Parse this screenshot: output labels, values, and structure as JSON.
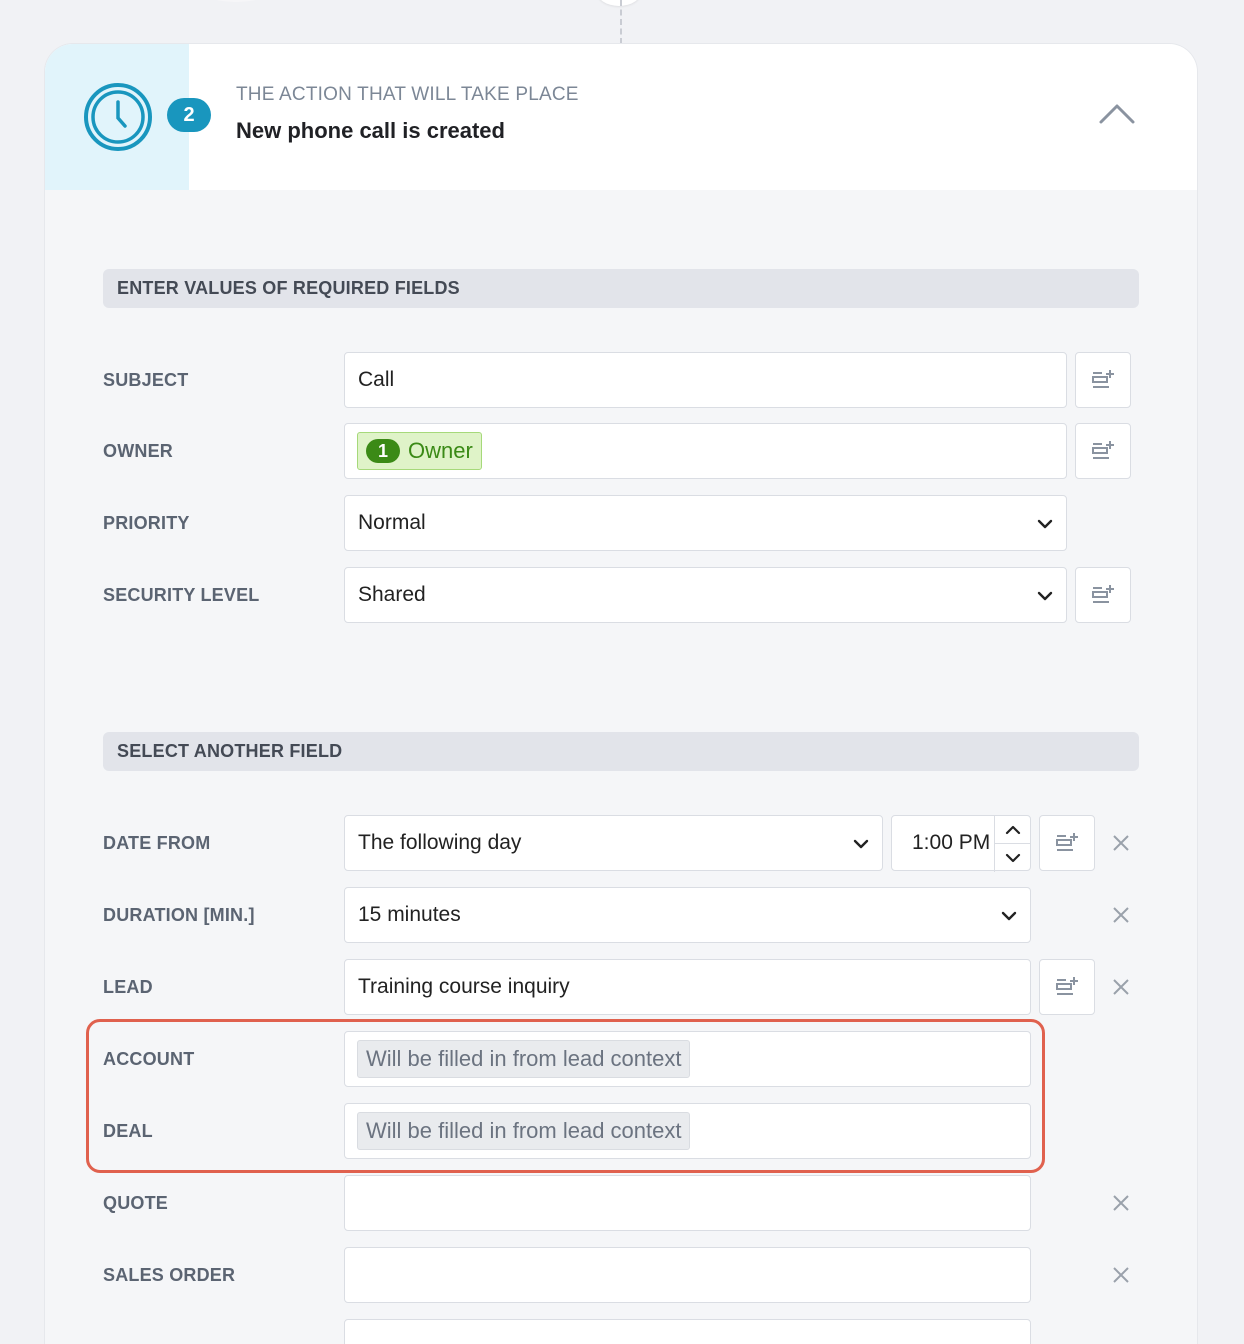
{
  "header": {
    "step_number": "2",
    "caption": "THE ACTION THAT WILL TAKE PLACE",
    "title": "New phone call is created"
  },
  "required_section": {
    "title": "ENTER VALUES OF REQUIRED FIELDS",
    "fields": {
      "subject": {
        "label": "SUBJECT",
        "value": "Call"
      },
      "owner": {
        "label": "OWNER",
        "tag_number": "1",
        "tag_label": "Owner"
      },
      "priority": {
        "label": "PRIORITY",
        "value": "Normal"
      },
      "security_level": {
        "label": "SECURITY LEVEL",
        "value": "Shared"
      }
    }
  },
  "another_section": {
    "title": "SELECT ANOTHER FIELD",
    "fields": {
      "date_from": {
        "label": "DATE FROM",
        "value": "The following day",
        "time": "1:00 PM"
      },
      "duration": {
        "label": "DURATION [MIN.]",
        "value": "15 minutes"
      },
      "lead": {
        "label": "LEAD",
        "value": "Training course inquiry"
      },
      "account": {
        "label": "ACCOUNT",
        "tag": "Will be filled in from lead context"
      },
      "deal": {
        "label": "DEAL",
        "tag": "Will be filled in from lead context"
      },
      "quote": {
        "label": "QUOTE",
        "value": ""
      },
      "sales_order": {
        "label": "SALES ORDER",
        "value": ""
      }
    }
  },
  "colors": {
    "accent": "#1996be",
    "highlight": "#e0614e",
    "owner_tag": "#3b8a16"
  }
}
